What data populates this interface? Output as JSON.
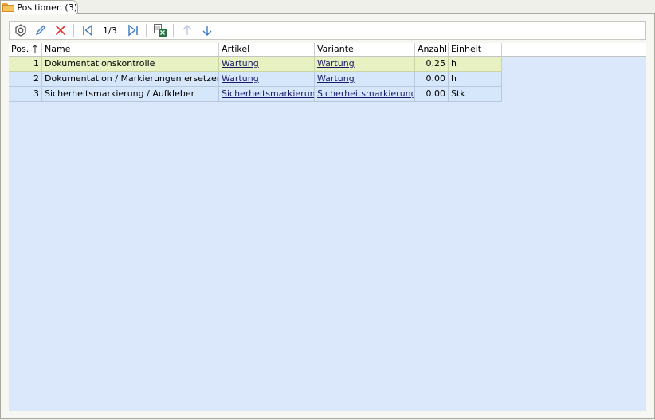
{
  "tab": {
    "label": "Positionen (3)"
  },
  "toolbar": {
    "pager": "1/3",
    "buttons": [
      "settings-icon",
      "edit-icon",
      "delete-icon",
      "first-icon",
      "last-icon",
      "excel-export-icon",
      "move-up-icon",
      "move-down-icon"
    ]
  },
  "grid": {
    "headers": [
      "Pos.",
      "Name",
      "Artikel",
      "Variante",
      "Anzahl",
      "Einheit"
    ],
    "rows": [
      {
        "pos": "1",
        "name": "Dokumentationskontrolle",
        "artikel": "Wartung",
        "variante": "Wartung",
        "anzahl": "0.25",
        "einheit": "h"
      },
      {
        "pos": "2",
        "name": "Dokumentation / Markierungen ersetzen",
        "artikel": "Wartung",
        "variante": "Wartung",
        "anzahl": "0.00",
        "einheit": "h"
      },
      {
        "pos": "3",
        "name": "Sicherheitsmarkierung / Aufkleber",
        "artikel": "Sicherheitsmarkierung",
        "variante": "Sicherheitsmarkierung",
        "anzahl": "0.00",
        "einheit": "Stk"
      }
    ]
  },
  "colors": {
    "grid_bg": "#dbe8fb",
    "selected_row": "#e7f1c2",
    "row": "#d6e6fb"
  }
}
